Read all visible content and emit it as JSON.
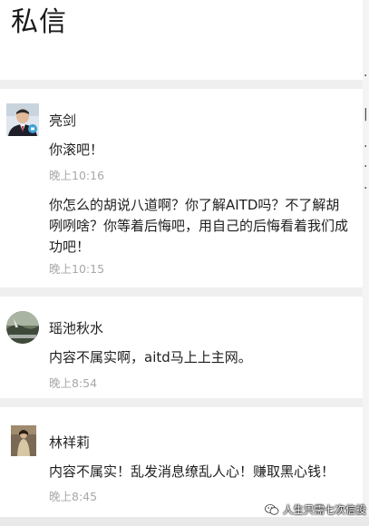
{
  "header": {
    "title": "私信"
  },
  "conversations": [
    {
      "sender": "亮剑",
      "messages": [
        {
          "text": "你滚吧！",
          "time": "晚上10:16"
        },
        {
          "text": "你怎么的胡说八道啊？你了解AITD吗？不了解胡咧咧啥？你等着后悔吧，用自己的后悔看着我们成功吧！",
          "time": "晚上10:15"
        }
      ]
    },
    {
      "sender": "瑶池秋水",
      "messages": [
        {
          "text": "内容不属实啊，aitd马上上主网。",
          "time": "晚上8:54"
        }
      ]
    },
    {
      "sender": "林祥莉",
      "messages": [
        {
          "text": "内容不属实！乱发消息缭乱人心！赚取黑心钱！",
          "time": "晚上8:45"
        }
      ]
    }
  ],
  "watermark": {
    "text": "人生只需七次信投",
    "icon": "wechat-icon"
  },
  "colors": {
    "background": "#efefef",
    "card": "#ffffff",
    "time_text": "#a8a8a8",
    "primary_text": "#1e1e1e"
  }
}
